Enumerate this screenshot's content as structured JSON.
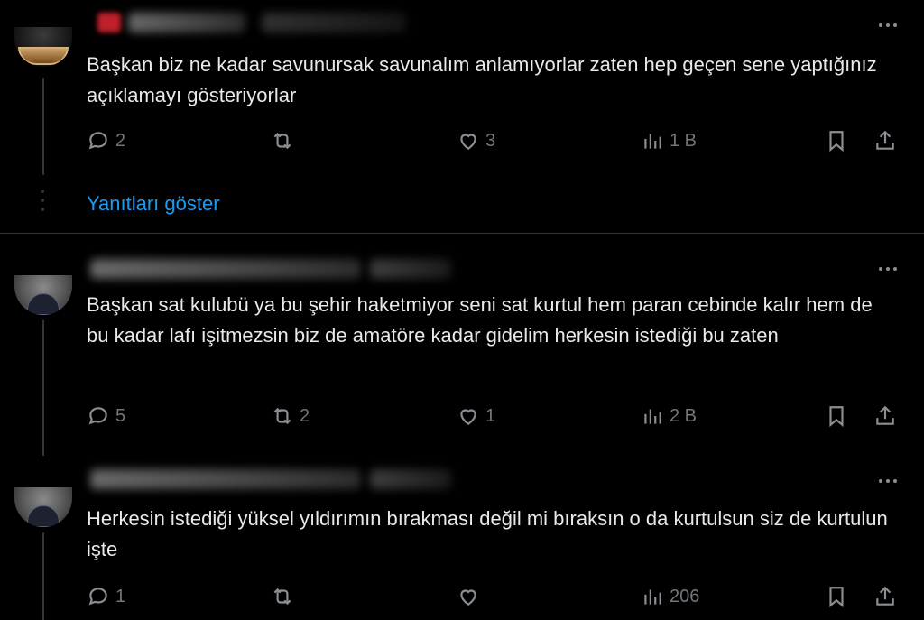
{
  "replies": [
    {
      "text": "Başkan biz ne kadar savunursak savunalım anlamıyorlar zaten hep geçen sene yaptığınız açıklamayı gösteriyorlar",
      "reply_count": "2",
      "retweet_count": "",
      "like_count": "3",
      "views": "1 B"
    },
    {
      "text": "Başkan sat kulubü ya bu şehir haketmiyor seni sat kurtul hem paran cebinde kalır hem de bu kadar lafı işitmezsin biz de amatöre kadar gidelim herkesin istediği bu zaten",
      "reply_count": "5",
      "retweet_count": "2",
      "like_count": "1",
      "views": "2 B"
    },
    {
      "text": "Herkesin istediği yüksel yıldırımın bırakması değil mi bıraksın o da kurtulsun siz de kurtulun işte",
      "reply_count": "1",
      "retweet_count": "",
      "like_count": "",
      "views": "206"
    }
  ],
  "show_replies_label": "Yanıtları göster",
  "colors": {
    "background": "#000000",
    "text": "#e7e9ea",
    "muted": "#71767b",
    "link": "#1d9bf0"
  },
  "icons": [
    "reply-icon",
    "retweet-icon",
    "like-icon",
    "views-icon",
    "bookmark-icon",
    "share-icon",
    "more-icon"
  ]
}
